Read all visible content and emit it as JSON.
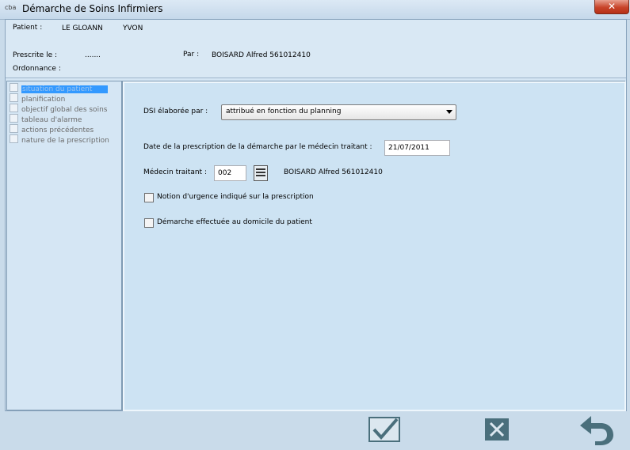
{
  "window": {
    "icon_text": "cba",
    "title": "Démarche de Soins Infirmiers",
    "close_glyph": "✕"
  },
  "header": {
    "patient_label": "Patient :",
    "patient_name": "LE GLOANN",
    "patient_firstname": "YVON",
    "prescrite_label": "Prescrite le :",
    "prescrite_value": ".......",
    "par_label": "Par :",
    "par_value": "BOISARD Alfred 561012410",
    "ordonnance_label": "Ordonnance :"
  },
  "tree": {
    "items": [
      {
        "label": "situation du patient",
        "selected": true
      },
      {
        "label": "planification"
      },
      {
        "label": "objectif global des soins"
      },
      {
        "label": "tableau d'alarme"
      },
      {
        "label": "actions précédentes"
      },
      {
        "label": "nature de la prescription"
      }
    ]
  },
  "form": {
    "dsi_label": "DSI élaborée par :",
    "dsi_value": "attribué en fonction du planning",
    "date_label": "Date de la prescription de la démarche par le médecin traitant :",
    "date_value": "21/07/2011",
    "medecin_label": "Médecin traitant :",
    "medecin_code": "002",
    "medecin_name": "BOISARD Alfred 561012410",
    "urgence_label": "Notion d'urgence indiqué sur la prescription",
    "domicile_label": "Démarche effectuée au domicile du patient"
  },
  "colors": {
    "background": "#c9dbea",
    "selection": "#3399ff",
    "button_icon": "#4a6f7c"
  },
  "footer": {
    "buttons": [
      "validate-icon",
      "cancel-icon",
      "back-icon"
    ]
  }
}
